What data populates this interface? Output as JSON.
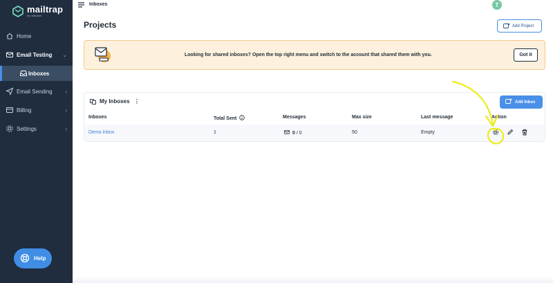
{
  "brand": {
    "name": "mailtrap",
    "sub": "by railsware"
  },
  "sidebar": {
    "items": [
      {
        "label": "Home",
        "icon": "home-icon"
      },
      {
        "label": "Email Testing",
        "icon": "email-testing-icon",
        "chevron": "⌄"
      },
      {
        "label": "Inboxes",
        "icon": "inbox-icon"
      },
      {
        "label": "Email Sending",
        "icon": "send-icon",
        "chevron": "›"
      },
      {
        "label": "Billing",
        "icon": "billing-icon",
        "chevron": "›"
      },
      {
        "label": "Settings",
        "icon": "gear-icon",
        "chevron": "›"
      }
    ],
    "help_label": "Help"
  },
  "topbar": {
    "breadcrumb": "Inboxes",
    "avatar_initial": "T"
  },
  "page": {
    "title": "Projects",
    "add_project_label": "Add Project"
  },
  "banner": {
    "text": "Looking for shared inboxes? Open the top right menu and switch to the account that shared them with you.",
    "button_label": "Got it"
  },
  "inboxes": {
    "title": "My Inboxes",
    "add_label": "Add Inbox",
    "columns": [
      "Inboxes",
      "Total Sent",
      "Messages",
      "Max size",
      "Last message",
      "Action"
    ],
    "rows": [
      {
        "name": "Demo inbox",
        "total_sent": "1",
        "messages_unread": "0",
        "messages_sep": " / 0",
        "max_size": "50",
        "last_message": "Empty"
      }
    ]
  },
  "colors": {
    "sidebar": "#1f2d3f",
    "accent": "#3f8de4",
    "banner": "#fdf0dc",
    "annotation": "#ecec1a"
  }
}
